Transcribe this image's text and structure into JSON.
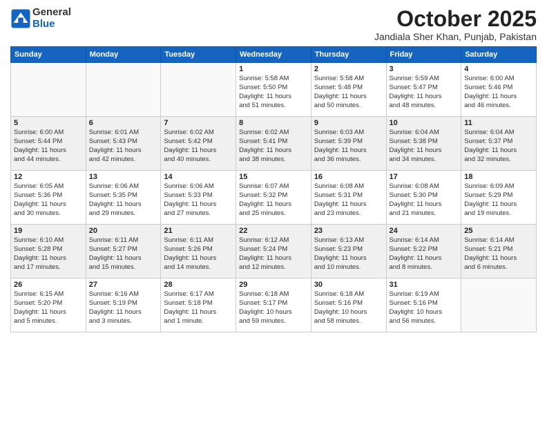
{
  "logo": {
    "general": "General",
    "blue": "Blue"
  },
  "header": {
    "month": "October 2025",
    "location": "Jandiala Sher Khan, Punjab, Pakistan"
  },
  "weekdays": [
    "Sunday",
    "Monday",
    "Tuesday",
    "Wednesday",
    "Thursday",
    "Friday",
    "Saturday"
  ],
  "weeks": [
    [
      {
        "day": "",
        "info": ""
      },
      {
        "day": "",
        "info": ""
      },
      {
        "day": "",
        "info": ""
      },
      {
        "day": "1",
        "info": "Sunrise: 5:58 AM\nSunset: 5:50 PM\nDaylight: 11 hours\nand 51 minutes."
      },
      {
        "day": "2",
        "info": "Sunrise: 5:58 AM\nSunset: 5:48 PM\nDaylight: 11 hours\nand 50 minutes."
      },
      {
        "day": "3",
        "info": "Sunrise: 5:59 AM\nSunset: 5:47 PM\nDaylight: 11 hours\nand 48 minutes."
      },
      {
        "day": "4",
        "info": "Sunrise: 6:00 AM\nSunset: 5:46 PM\nDaylight: 11 hours\nand 46 minutes."
      }
    ],
    [
      {
        "day": "5",
        "info": "Sunrise: 6:00 AM\nSunset: 5:44 PM\nDaylight: 11 hours\nand 44 minutes."
      },
      {
        "day": "6",
        "info": "Sunrise: 6:01 AM\nSunset: 5:43 PM\nDaylight: 11 hours\nand 42 minutes."
      },
      {
        "day": "7",
        "info": "Sunrise: 6:02 AM\nSunset: 5:42 PM\nDaylight: 11 hours\nand 40 minutes."
      },
      {
        "day": "8",
        "info": "Sunrise: 6:02 AM\nSunset: 5:41 PM\nDaylight: 11 hours\nand 38 minutes."
      },
      {
        "day": "9",
        "info": "Sunrise: 6:03 AM\nSunset: 5:39 PM\nDaylight: 11 hours\nand 36 minutes."
      },
      {
        "day": "10",
        "info": "Sunrise: 6:04 AM\nSunset: 5:38 PM\nDaylight: 11 hours\nand 34 minutes."
      },
      {
        "day": "11",
        "info": "Sunrise: 6:04 AM\nSunset: 5:37 PM\nDaylight: 11 hours\nand 32 minutes."
      }
    ],
    [
      {
        "day": "12",
        "info": "Sunrise: 6:05 AM\nSunset: 5:36 PM\nDaylight: 11 hours\nand 30 minutes."
      },
      {
        "day": "13",
        "info": "Sunrise: 6:06 AM\nSunset: 5:35 PM\nDaylight: 11 hours\nand 29 minutes."
      },
      {
        "day": "14",
        "info": "Sunrise: 6:06 AM\nSunset: 5:33 PM\nDaylight: 11 hours\nand 27 minutes."
      },
      {
        "day": "15",
        "info": "Sunrise: 6:07 AM\nSunset: 5:32 PM\nDaylight: 11 hours\nand 25 minutes."
      },
      {
        "day": "16",
        "info": "Sunrise: 6:08 AM\nSunset: 5:31 PM\nDaylight: 11 hours\nand 23 minutes."
      },
      {
        "day": "17",
        "info": "Sunrise: 6:08 AM\nSunset: 5:30 PM\nDaylight: 11 hours\nand 21 minutes."
      },
      {
        "day": "18",
        "info": "Sunrise: 6:09 AM\nSunset: 5:29 PM\nDaylight: 11 hours\nand 19 minutes."
      }
    ],
    [
      {
        "day": "19",
        "info": "Sunrise: 6:10 AM\nSunset: 5:28 PM\nDaylight: 11 hours\nand 17 minutes."
      },
      {
        "day": "20",
        "info": "Sunrise: 6:11 AM\nSunset: 5:27 PM\nDaylight: 11 hours\nand 15 minutes."
      },
      {
        "day": "21",
        "info": "Sunrise: 6:11 AM\nSunset: 5:26 PM\nDaylight: 11 hours\nand 14 minutes."
      },
      {
        "day": "22",
        "info": "Sunrise: 6:12 AM\nSunset: 5:24 PM\nDaylight: 11 hours\nand 12 minutes."
      },
      {
        "day": "23",
        "info": "Sunrise: 6:13 AM\nSunset: 5:23 PM\nDaylight: 11 hours\nand 10 minutes."
      },
      {
        "day": "24",
        "info": "Sunrise: 6:14 AM\nSunset: 5:22 PM\nDaylight: 11 hours\nand 8 minutes."
      },
      {
        "day": "25",
        "info": "Sunrise: 6:14 AM\nSunset: 5:21 PM\nDaylight: 11 hours\nand 6 minutes."
      }
    ],
    [
      {
        "day": "26",
        "info": "Sunrise: 6:15 AM\nSunset: 5:20 PM\nDaylight: 11 hours\nand 5 minutes."
      },
      {
        "day": "27",
        "info": "Sunrise: 6:16 AM\nSunset: 5:19 PM\nDaylight: 11 hours\nand 3 minutes."
      },
      {
        "day": "28",
        "info": "Sunrise: 6:17 AM\nSunset: 5:18 PM\nDaylight: 11 hours\nand 1 minute."
      },
      {
        "day": "29",
        "info": "Sunrise: 6:18 AM\nSunset: 5:17 PM\nDaylight: 10 hours\nand 59 minutes."
      },
      {
        "day": "30",
        "info": "Sunrise: 6:18 AM\nSunset: 5:16 PM\nDaylight: 10 hours\nand 58 minutes."
      },
      {
        "day": "31",
        "info": "Sunrise: 6:19 AM\nSunset: 5:16 PM\nDaylight: 10 hours\nand 56 minutes."
      },
      {
        "day": "",
        "info": ""
      }
    ]
  ]
}
